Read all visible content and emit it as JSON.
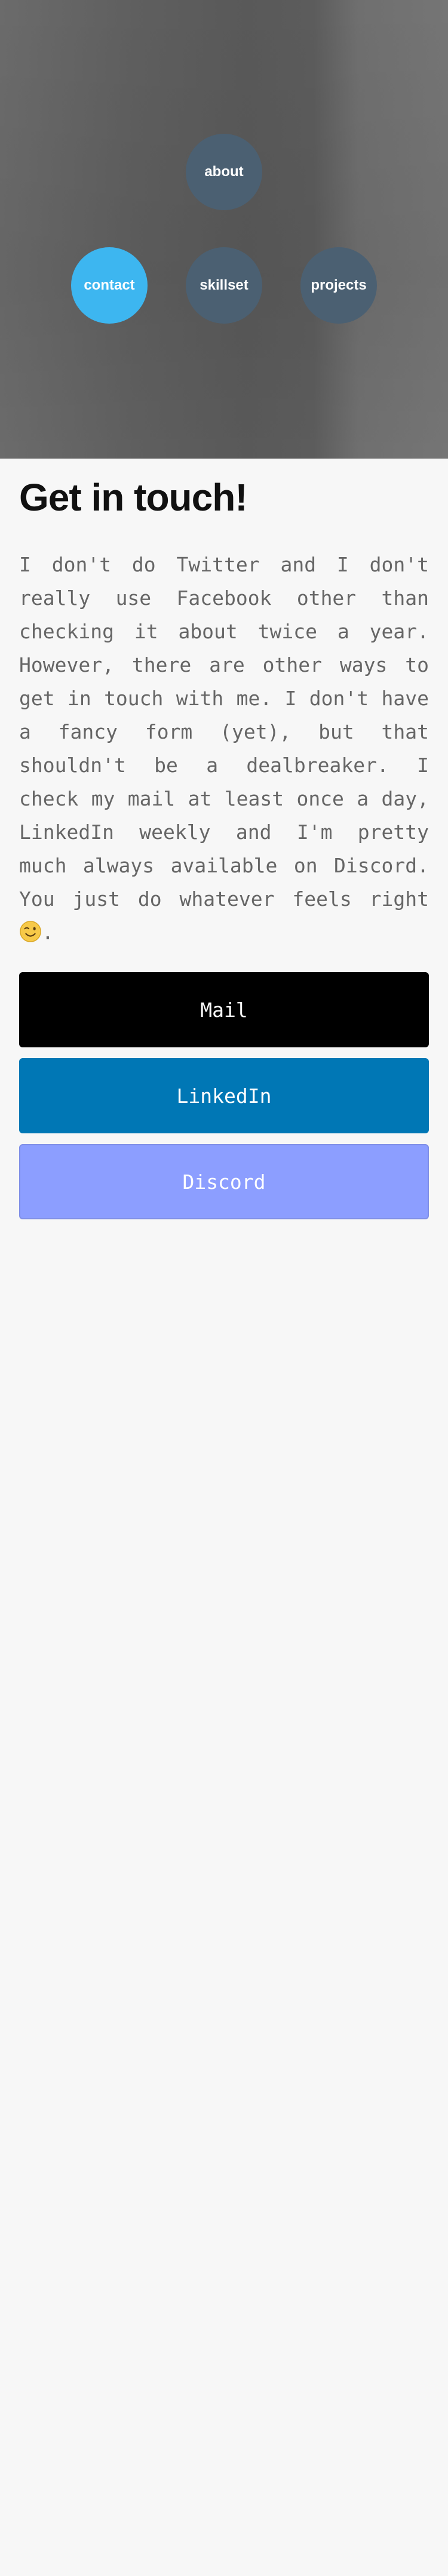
{
  "nav": {
    "about": "about",
    "contact": "contact",
    "skillset": "skillset",
    "projects": "projects",
    "active": "contact"
  },
  "colors": {
    "nav_inactive": "#4b6072",
    "nav_active": "#3db6f0",
    "mail_button": "#000000",
    "linkedin_button": "#0077b5",
    "discord_button": "#8c9eff",
    "page_background": "#f7f7f7"
  },
  "main": {
    "title": "Get in touch!",
    "intro": "I don't do Twitter and I don't really use Facebook other than checking it about twice a year. However, there are other ways to get in touch with me. I don't have a fancy form (yet), but that shouldn't be a dealbreaker. I check my mail at least once a day, LinkedIn weekly and I'm pretty much always available on Discord. You just do whatever feels right",
    "intro_end": ".",
    "emoji": "winking-face-icon"
  },
  "buttons": {
    "mail": "Mail",
    "linkedin": "LinkedIn",
    "discord": "Discord"
  }
}
